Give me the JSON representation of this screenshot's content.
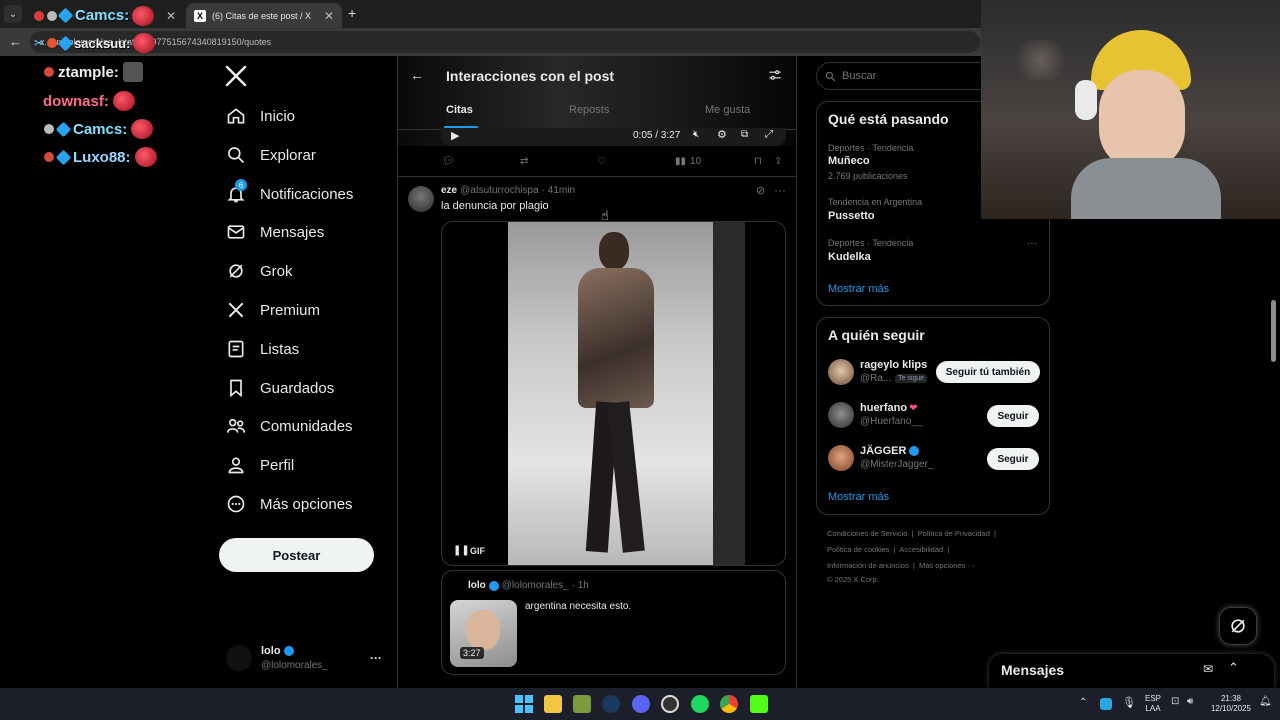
{
  "browser": {
    "tab1_title": "Camcs:",
    "tab2_title": "(6) Citas de este post / X",
    "new_tab": "+",
    "url": "x.com/lolomorales_/status/1977515674340819150/quotes",
    "url_overlay": "sacksuu:"
  },
  "chat": [
    {
      "user": "ztample:",
      "color": "#f0f0f0"
    },
    {
      "user": "downasf:",
      "color": "#ff6b8b"
    },
    {
      "user": "Camcs:",
      "color": "#7fe0ff"
    },
    {
      "user": "Luxo88:",
      "color": "#9ad7ff"
    }
  ],
  "nav": {
    "logo": "X",
    "items": [
      {
        "label": "Inicio",
        "icon": "home-icon"
      },
      {
        "label": "Explorar",
        "icon": "search-icon"
      },
      {
        "label": "Notificaciones",
        "icon": "bell-icon",
        "badge": "6"
      },
      {
        "label": "Mensajes",
        "icon": "mail-icon"
      },
      {
        "label": "Grok",
        "icon": "grok-icon"
      },
      {
        "label": "Premium",
        "icon": "x-icon"
      },
      {
        "label": "Listas",
        "icon": "list-icon"
      },
      {
        "label": "Guardados",
        "icon": "bookmark-icon"
      },
      {
        "label": "Comunidades",
        "icon": "people-icon"
      },
      {
        "label": "Perfil",
        "icon": "person-icon"
      },
      {
        "label": "Más opciones",
        "icon": "more-circle-icon"
      }
    ],
    "post_button": "Postear",
    "account": {
      "name": "lolo",
      "handle": "@lolomorales_",
      "more": "···"
    }
  },
  "center": {
    "title": "Interacciones con el post",
    "tabs": [
      "Citas",
      "Reposts",
      "Me gusta"
    ],
    "video_time": "0:05 / 3:27",
    "prev_views": "10",
    "tweet": {
      "name": "eze",
      "handle": "@atsuturrochispa",
      "time": "· 41min",
      "text": "la denuncia por plagio",
      "gif_label": "GIF",
      "quoted": {
        "name": "lolo",
        "handle": "@lolomorales_",
        "time": "· 1h",
        "text": "argentina necesita esto.",
        "duration": "3:27"
      }
    }
  },
  "right": {
    "search_placeholder": "Buscar",
    "trends_title": "Qué está pasando",
    "trends": [
      {
        "category": "Deportes · Tendencia",
        "name": "Muñeco",
        "count": "2.769 publicaciones"
      },
      {
        "category": "Tendencia en Argentina",
        "name": "Pussetto",
        "count": ""
      },
      {
        "category": "Deportes · Tendencia",
        "name": "Kudelka",
        "count": ""
      }
    ],
    "show_more": "Mostrar más",
    "follow_title": "A quién seguir",
    "follow": [
      {
        "name": "rageylo klips",
        "handle": "@Ra...",
        "tag": "Te sigue",
        "button": "Seguir tú también"
      },
      {
        "name": "huerfano",
        "handle": "@Huerfano__",
        "tag": "",
        "button": "Seguir"
      },
      {
        "name": "JÄGGER",
        "handle": "@MisterJagger_",
        "tag": "",
        "button": "Seguir"
      }
    ],
    "footer": {
      "line1a": "Condiciones de Servicio",
      "line1b": "Política de Privacidad",
      "line2a": "Política de cookies",
      "line2b": "Accesibilidad",
      "line3a": "Información de anuncios",
      "line3b": "Más opciones ···",
      "copyright": "© 2025 X Corp."
    }
  },
  "messages": {
    "title": "Mensajes"
  },
  "taskbar": {
    "lang1": "ESP",
    "lang2": "LAA",
    "time": "21:38",
    "date": "12/10/2025"
  }
}
